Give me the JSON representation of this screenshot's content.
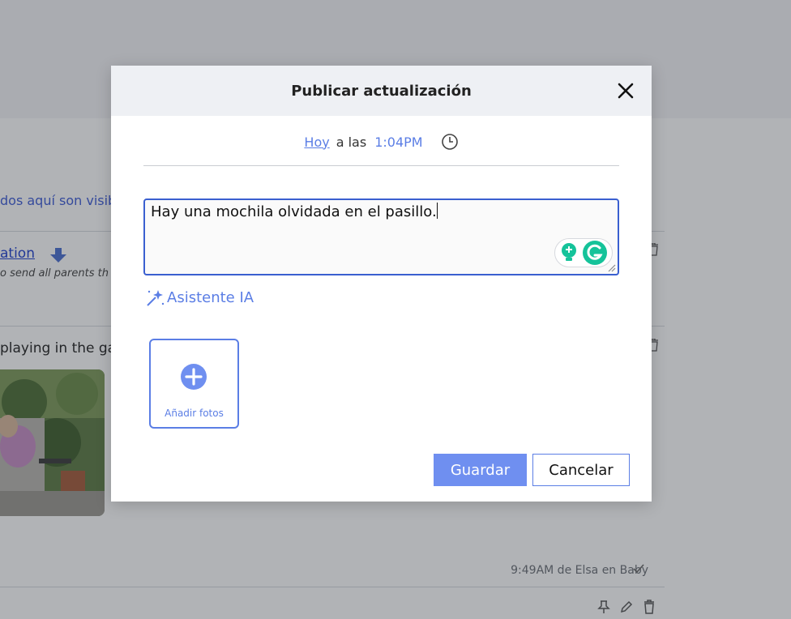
{
  "background": {
    "visible_text": "dos aquí son visibl",
    "notification_link": "ation",
    "notification_sub": "o send all parents th",
    "post_text": "playing in the ga",
    "post_meta": "9:49AM de Elsa en Baby"
  },
  "modal": {
    "title": "Publicar actualización",
    "when": {
      "day": "Hoy",
      "at_label": "a las",
      "time": "1:04PM"
    },
    "textarea_value": "Hay una mochila olvidada en el pasillo.",
    "ai_assistant_label": "Asistente IA",
    "add_photos_label": "Añadir fotos",
    "save_label": "Guardar",
    "cancel_label": "Cancelar"
  },
  "colors": {
    "accent": "#5b7ee5",
    "save_button": "#6f8ff0",
    "textarea_border": "#3a5fd0",
    "modal_header": "#eef0f4",
    "grammarly_green": "#15c39a"
  },
  "icons": {
    "close": "close-icon",
    "clock": "clock-icon",
    "ai": "magic-wand-icon",
    "add_photo": "plus-circle-icon",
    "grammarly": "grammarly-icon"
  }
}
